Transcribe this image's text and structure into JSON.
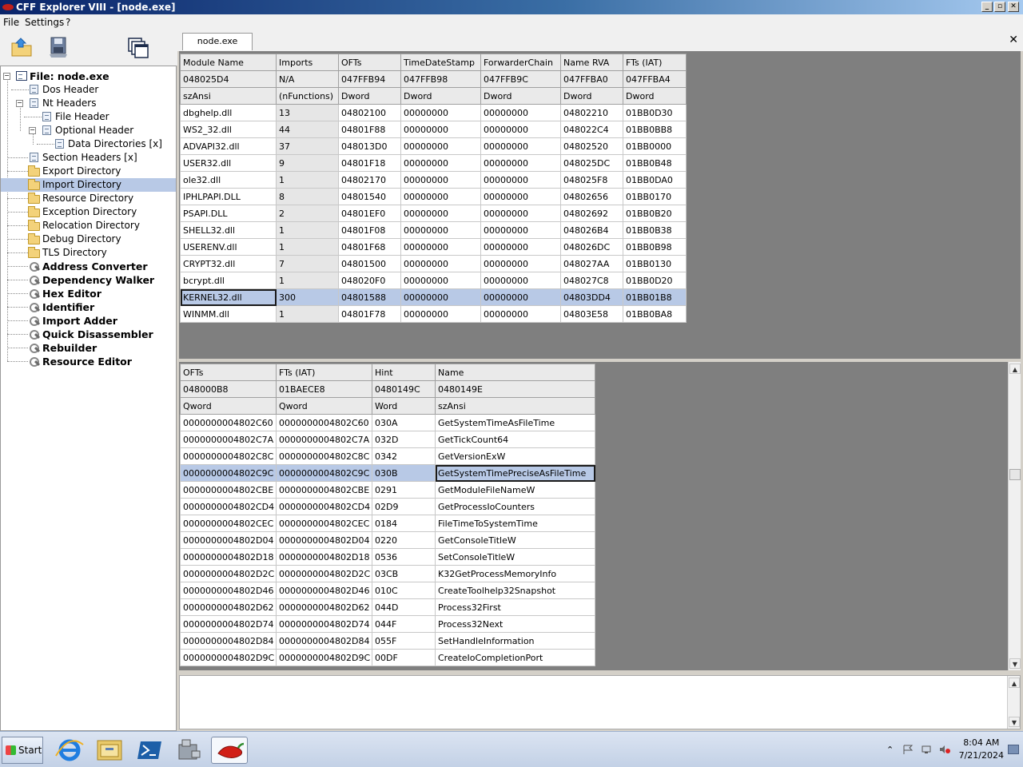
{
  "window": {
    "title": "CFF Explorer VIII - [node.exe]"
  },
  "menu": [
    "File",
    "Settings",
    "?"
  ],
  "tab": {
    "label": "node.exe"
  },
  "tree": {
    "root": "File: node.exe",
    "items": [
      {
        "label": "Dos Header",
        "icon": "document-icon"
      },
      {
        "label": "Nt Headers",
        "icon": "document-icon"
      },
      {
        "label": "File Header",
        "icon": "document-icon"
      },
      {
        "label": "Optional Header",
        "icon": "document-icon"
      },
      {
        "label": "Data Directories [x]",
        "icon": "document-icon"
      },
      {
        "label": "Section Headers [x]",
        "icon": "document-icon"
      },
      {
        "label": "Export Directory",
        "icon": "folder-icon"
      },
      {
        "label": "Import Directory",
        "icon": "folder-icon",
        "selected": true
      },
      {
        "label": "Resource Directory",
        "icon": "folder-icon"
      },
      {
        "label": "Exception Directory",
        "icon": "folder-icon"
      },
      {
        "label": "Relocation Directory",
        "icon": "folder-icon"
      },
      {
        "label": "Debug Directory",
        "icon": "folder-icon"
      },
      {
        "label": "TLS Directory",
        "icon": "folder-icon"
      },
      {
        "label": "Address Converter",
        "icon": "tool-icon"
      },
      {
        "label": "Dependency Walker",
        "icon": "tool-icon"
      },
      {
        "label": "Hex Editor",
        "icon": "tool-icon"
      },
      {
        "label": "Identifier",
        "icon": "tool-icon"
      },
      {
        "label": "Import Adder",
        "icon": "tool-icon"
      },
      {
        "label": "Quick Disassembler",
        "icon": "tool-icon"
      },
      {
        "label": "Rebuilder",
        "icon": "tool-icon"
      },
      {
        "label": "Resource Editor",
        "icon": "tool-icon"
      }
    ]
  },
  "modules": {
    "headers": [
      "Module Name",
      "Imports",
      "OFTs",
      "TimeDateStamp",
      "ForwarderChain",
      "Name RVA",
      "FTs (IAT)"
    ],
    "offsets": [
      "048025D4",
      "N/A",
      "047FFB94",
      "047FFB98",
      "047FFB9C",
      "047FFBA0",
      "047FFBA4"
    ],
    "types": [
      "szAnsi",
      "(nFunctions)",
      "Dword",
      "Dword",
      "Dword",
      "Dword",
      "Dword"
    ],
    "rows": [
      [
        "dbghelp.dll",
        "13",
        "04802100",
        "00000000",
        "00000000",
        "04802210",
        "01BB0D30"
      ],
      [
        "WS2_32.dll",
        "44",
        "04801F88",
        "00000000",
        "00000000",
        "048022C4",
        "01BB0BB8"
      ],
      [
        "ADVAPI32.dll",
        "37",
        "048013D0",
        "00000000",
        "00000000",
        "04802520",
        "01BB0000"
      ],
      [
        "USER32.dll",
        "9",
        "04801F18",
        "00000000",
        "00000000",
        "048025DC",
        "01BB0B48"
      ],
      [
        "ole32.dll",
        "1",
        "04802170",
        "00000000",
        "00000000",
        "048025F8",
        "01BB0DA0"
      ],
      [
        "IPHLPAPI.DLL",
        "8",
        "04801540",
        "00000000",
        "00000000",
        "04802656",
        "01BB0170"
      ],
      [
        "PSAPI.DLL",
        "2",
        "04801EF0",
        "00000000",
        "00000000",
        "04802692",
        "01BB0B20"
      ],
      [
        "SHELL32.dll",
        "1",
        "04801F08",
        "00000000",
        "00000000",
        "048026B4",
        "01BB0B38"
      ],
      [
        "USERENV.dll",
        "1",
        "04801F68",
        "00000000",
        "00000000",
        "048026DC",
        "01BB0B98"
      ],
      [
        "CRYPT32.dll",
        "7",
        "04801500",
        "00000000",
        "00000000",
        "048027AA",
        "01BB0130"
      ],
      [
        "bcrypt.dll",
        "1",
        "048020F0",
        "00000000",
        "00000000",
        "048027C8",
        "01BB0D20"
      ],
      [
        "KERNEL32.dll",
        "300",
        "04801588",
        "00000000",
        "00000000",
        "04803DD4",
        "01BB01B8"
      ],
      [
        "WINMM.dll",
        "1",
        "04801F78",
        "00000000",
        "00000000",
        "04803E58",
        "01BB0BA8"
      ]
    ],
    "selected_index": 11
  },
  "functions": {
    "headers": [
      "OFTs",
      "FTs (IAT)",
      "Hint",
      "Name"
    ],
    "offsets": [
      "048000B8",
      "01BAECE8",
      "0480149C",
      "0480149E"
    ],
    "types": [
      "Qword",
      "Qword",
      "Word",
      "szAnsi"
    ],
    "rows": [
      [
        "0000000004802C60",
        "0000000004802C60",
        "030A",
        "GetSystemTimeAsFileTime"
      ],
      [
        "0000000004802C7A",
        "0000000004802C7A",
        "032D",
        "GetTickCount64"
      ],
      [
        "0000000004802C8C",
        "0000000004802C8C",
        "0342",
        "GetVersionExW"
      ],
      [
        "0000000004802C9C",
        "0000000004802C9C",
        "030B",
        "GetSystemTimePreciseAsFileTime"
      ],
      [
        "0000000004802CBE",
        "0000000004802CBE",
        "0291",
        "GetModuleFileNameW"
      ],
      [
        "0000000004802CD4",
        "0000000004802CD4",
        "02D9",
        "GetProcessIoCounters"
      ],
      [
        "0000000004802CEC",
        "0000000004802CEC",
        "0184",
        "FileTimeToSystemTime"
      ],
      [
        "0000000004802D04",
        "0000000004802D04",
        "0220",
        "GetConsoleTitleW"
      ],
      [
        "0000000004802D18",
        "0000000004802D18",
        "0536",
        "SetConsoleTitleW"
      ],
      [
        "0000000004802D2C",
        "0000000004802D2C",
        "03CB",
        "K32GetProcessMemoryInfo"
      ],
      [
        "0000000004802D46",
        "0000000004802D46",
        "010C",
        "CreateToolhelp32Snapshot"
      ],
      [
        "0000000004802D62",
        "0000000004802D62",
        "044D",
        "Process32First"
      ],
      [
        "0000000004802D74",
        "0000000004802D74",
        "044F",
        "Process32Next"
      ],
      [
        "0000000004802D84",
        "0000000004802D84",
        "055F",
        "SetHandleInformation"
      ],
      [
        "0000000004802D9C",
        "0000000004802D9C",
        "00DF",
        "CreateIoCompletionPort"
      ]
    ],
    "selected_index": 3
  },
  "taskbar": {
    "start_label": "Start",
    "apps": [
      "internet-explorer-icon",
      "file-explorer-icon",
      "powershell-icon",
      "server-manager-icon",
      "cff-explorer-icon"
    ],
    "active_app": "cff-explorer-icon",
    "clock_time": "8:04 AM",
    "clock_date": "7/21/2024"
  },
  "colors": {
    "selection": "#b8c9e6",
    "titlebar": "#0a246a",
    "pane_background": "#7f7f7f"
  }
}
